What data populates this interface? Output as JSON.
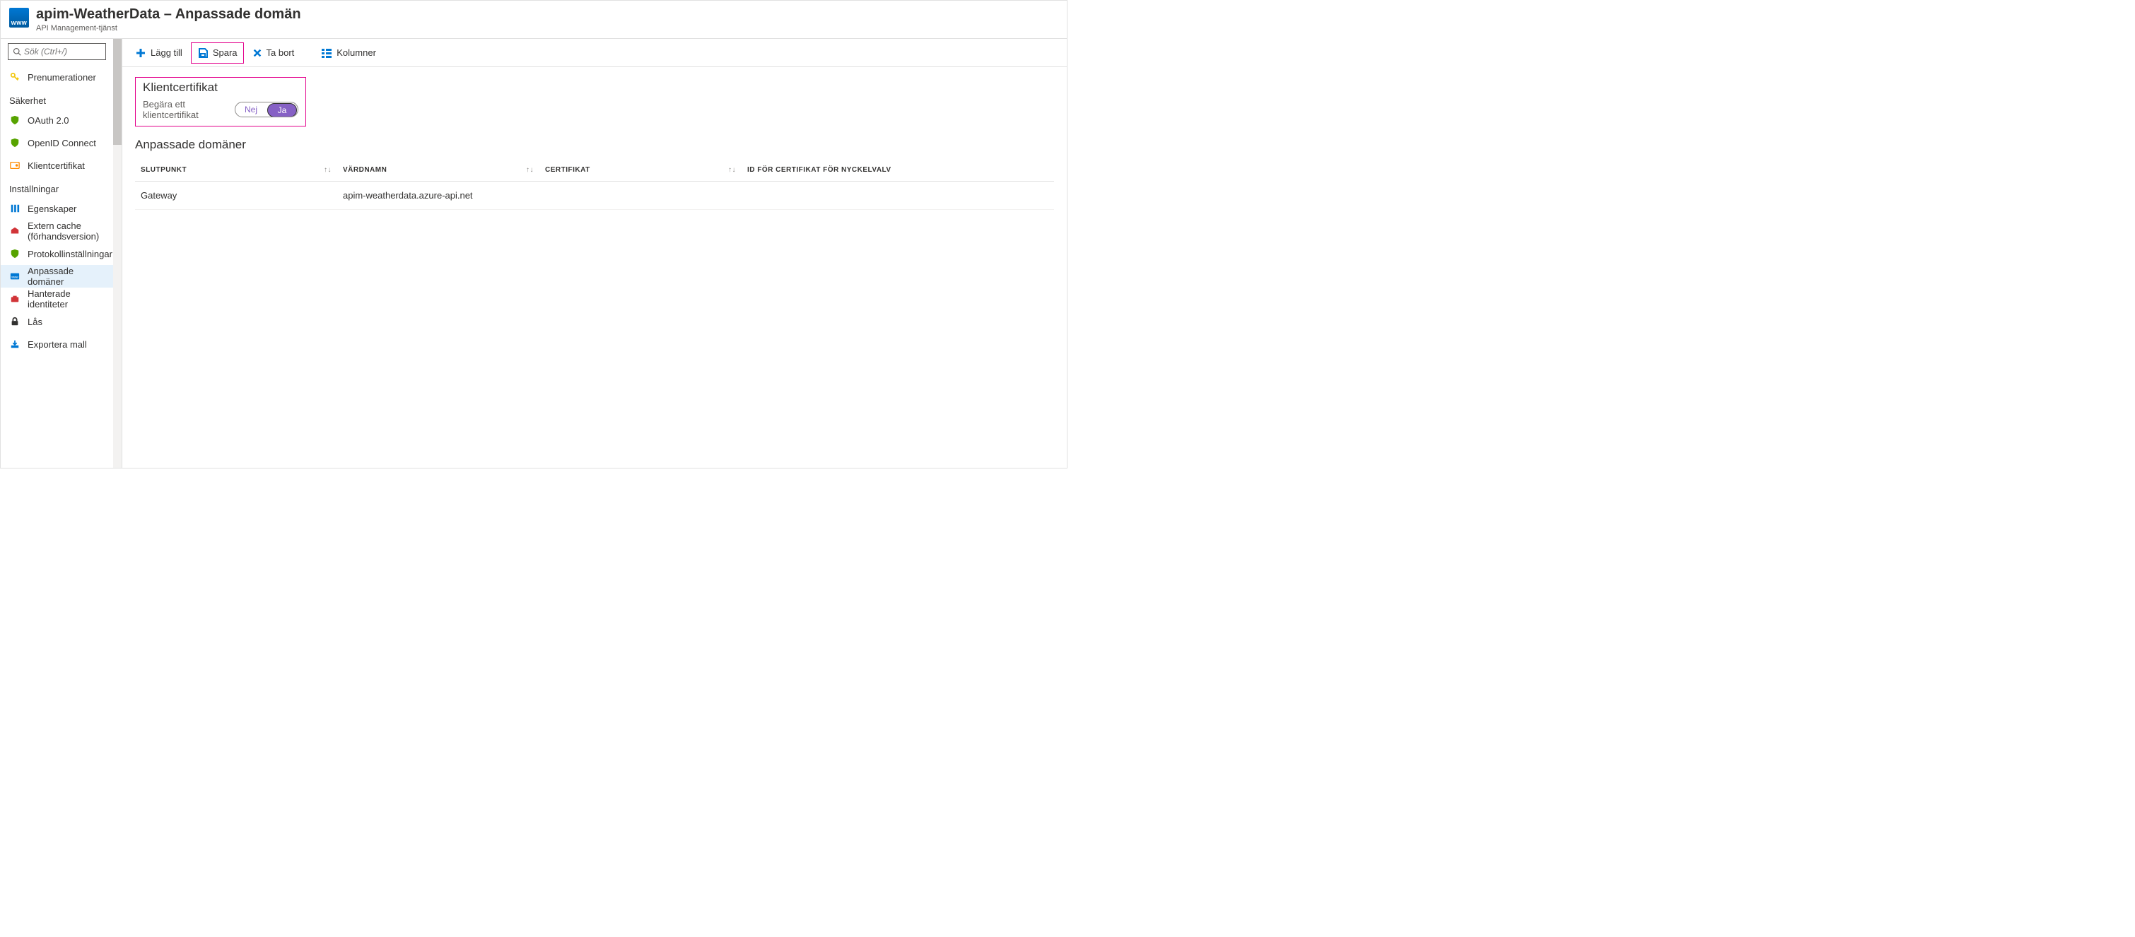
{
  "header": {
    "title": "apim-WeatherData – Anpassade domän",
    "subtitle": "API Management-tjänst",
    "icon_text": "www"
  },
  "sidebar": {
    "search_placeholder": "Sök (Ctrl+/)",
    "items_top": [
      {
        "label": "Prenumerationer",
        "icon": "key"
      }
    ],
    "group1_label": "Säkerhet",
    "items_security": [
      {
        "label": "OAuth 2.0",
        "icon": "shield"
      },
      {
        "label": "OpenID Connect",
        "icon": "shield"
      },
      {
        "label": "Klientcertifikat",
        "icon": "cert"
      }
    ],
    "group2_label": "Inställningar",
    "items_settings": [
      {
        "label": "Egenskaper",
        "icon": "props"
      },
      {
        "label": "Extern cache (förhandsversion)",
        "icon": "cache"
      },
      {
        "label": "Protokollinställningar",
        "icon": "shield"
      },
      {
        "label": "Anpassade domäner",
        "icon": "www",
        "active": true
      },
      {
        "label": "Hanterade identiteter",
        "icon": "ident"
      },
      {
        "label": "Lås",
        "icon": "lock"
      },
      {
        "label": "Exportera mall",
        "icon": "export"
      }
    ]
  },
  "toolbar": {
    "add": "Lägg till",
    "save": "Spara",
    "delete": "Ta bort",
    "columns": "Kolumner"
  },
  "client_cert": {
    "section_title": "Klientcertifikat",
    "label": "Begära ett klientcertifikat",
    "opt_no": "Nej",
    "opt_yes": "Ja"
  },
  "domains": {
    "section_title": "Anpassade domäner",
    "columns": {
      "endpoint": "SLUTPUNKT",
      "hostname": "VÄRDNAMN",
      "certificate": "CERTIFIKAT",
      "kv_cert_id": "ID FÖR CERTIFIKAT FÖR NYCKELVALV"
    },
    "rows": [
      {
        "endpoint": "Gateway",
        "hostname": "apim-weatherdata.azure-api.net",
        "certificate": "",
        "kv_cert_id": ""
      }
    ]
  }
}
